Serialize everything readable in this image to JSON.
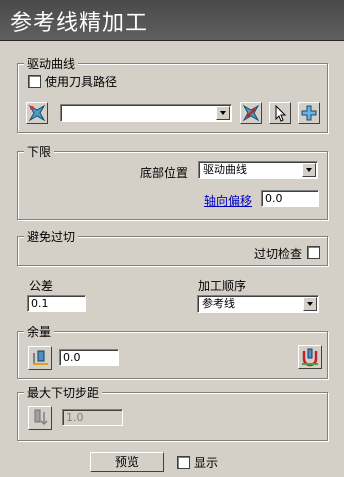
{
  "window": {
    "title": "参考线精加工"
  },
  "drive_curve": {
    "legend": "驱动曲线",
    "use_tool_path_label": "使用刀具路径",
    "use_tool_path_checked": false,
    "curve_value": ""
  },
  "lower_limit": {
    "legend": "下限",
    "bottom_position_label": "底部位置",
    "bottom_position_value": "驱动曲线",
    "axial_offset_label": "轴向偏移",
    "axial_offset_value": "0.0"
  },
  "avoid_gouge": {
    "legend": "避免过切",
    "gouge_check_label": "过切检查",
    "gouge_check_checked": false
  },
  "tolerance": {
    "label": "公差",
    "value": "0.1"
  },
  "machining_order": {
    "label": "加工顺序",
    "value": "参考线"
  },
  "allowance": {
    "legend": "余量",
    "value": "0.0"
  },
  "max_stepdown": {
    "legend": "最大下切步距",
    "value": "1.0"
  },
  "footer": {
    "preview_label": "预览",
    "display_label": "显示",
    "display_checked": false
  }
}
